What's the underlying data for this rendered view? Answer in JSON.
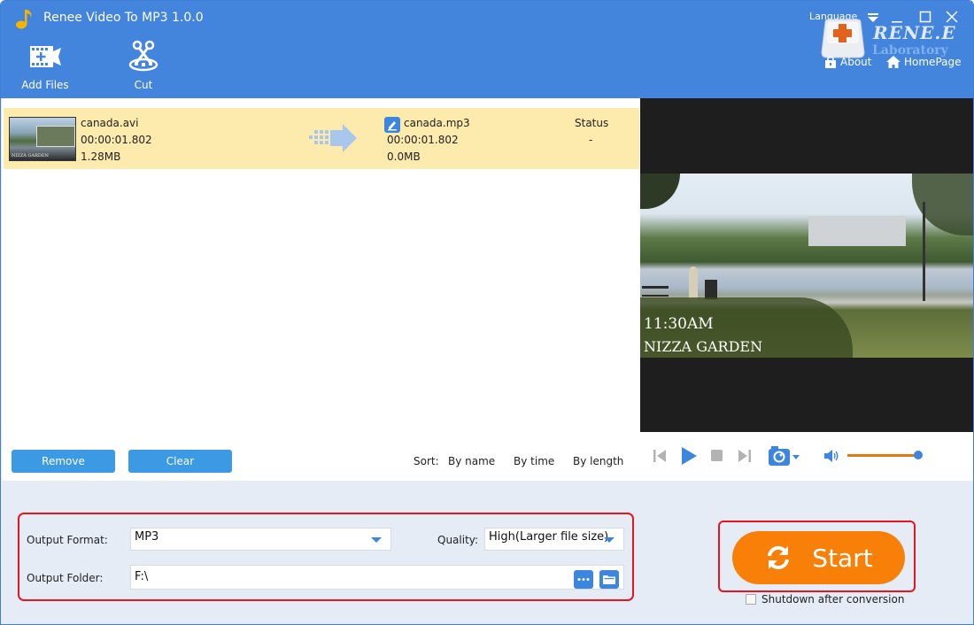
{
  "window": {
    "title": "Renee Video To MP3 1.0.0",
    "controls": [
      "minimize",
      "maximize",
      "close"
    ]
  },
  "toolbar": {
    "add_files_label": "Add Files",
    "cut_label": "Cut",
    "language_label": "Language",
    "about_label": "About",
    "homepage_label": "HomePage"
  },
  "logo": {
    "brand": "RENE.E",
    "sub": "Laboratory"
  },
  "file_list": {
    "items": [
      {
        "source_name": "canada.avi",
        "source_duration": "00:00:01.802",
        "source_size": "1.28MB",
        "output_name": "canada.mp3",
        "output_duration": "00:00:01.802",
        "output_size": "0.0MB",
        "status_header": "Status",
        "status_value": "-",
        "thumb_caption": "NIZZA GARDEN"
      }
    ],
    "remove_label": "Remove",
    "clear_label": "Clear",
    "sort_label": "Sort:",
    "sort_options": [
      "By name",
      "By time",
      "By length"
    ]
  },
  "preview": {
    "overlay_time": "11:30AM",
    "overlay_place": "NIZZA GARDEN",
    "volume_fraction": 1.0
  },
  "settings": {
    "output_format_label": "Output Format:",
    "output_format_value": "MP3",
    "quality_label": "Quality:",
    "quality_value": "High(Larger file size)",
    "output_folder_label": "Output Folder:",
    "output_folder_value": "F:\\"
  },
  "actions": {
    "start_label": "Start",
    "shutdown_label": "Shutdown after conversion",
    "shutdown_checked": false
  },
  "colors": {
    "header_blue": "#4384dc",
    "accent_blue": "#3d86e0",
    "button_blue": "#3b9ae3",
    "start_orange": "#f88008",
    "selected_row": "#fdeaad",
    "highlight_red": "#e8151e",
    "volume_orange": "#e07b14"
  }
}
